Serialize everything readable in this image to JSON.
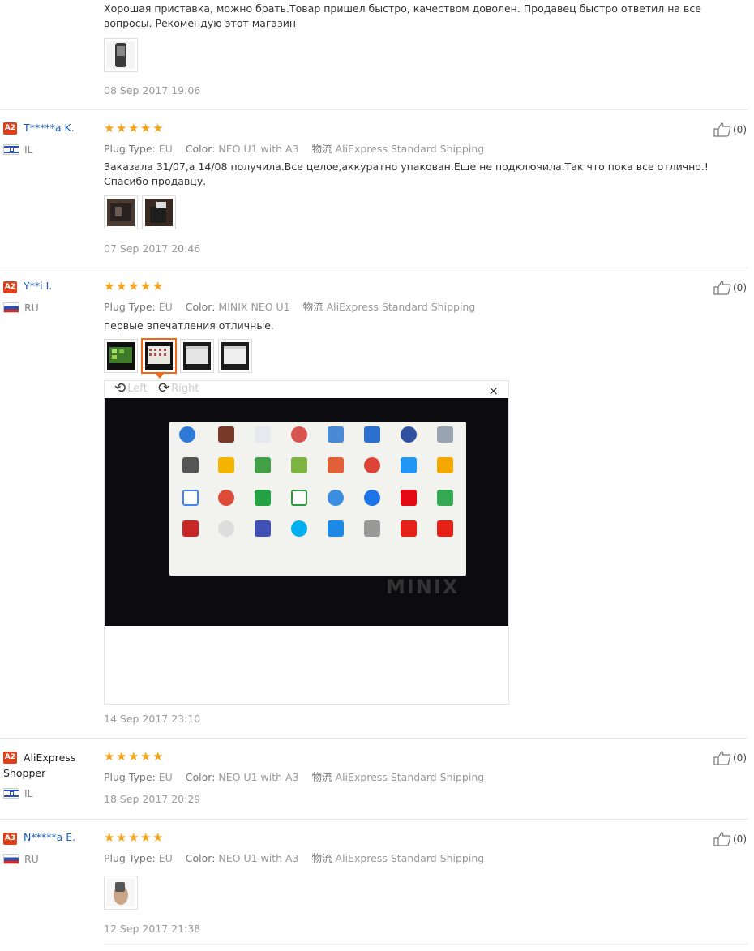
{
  "colors": {
    "accent": "#f06a16",
    "star": "#f7a21b",
    "link": "#1a5eb7",
    "level_badge": "#d9421c"
  },
  "labels": {
    "plug_type": "Plug Type:",
    "color": "Color:",
    "shipping": "物流"
  },
  "reviews": [
    {
      "text": "Хорошая приставка, можно брать.Товар пришел быстро, качеством доволен. Продавец быстро ответил на все вопросы. Рекомендую этот магазин",
      "date": "08 Sep 2017 19:06"
    },
    {
      "level": "A2",
      "name": "T*****a K.",
      "country": "IL",
      "rating": 5,
      "plug": "EU",
      "color": "NEO U1 with A3",
      "shipping": "AliExpress Standard Shipping",
      "text": "Заказала 31/07,а 14/08 получила.Все целое,аккуратно упакован.Еще не подключила.Так что пока все отлично.!Спасибо продавцу.",
      "likes": "(0)",
      "date": "07 Sep 2017 20:46"
    },
    {
      "level": "A2",
      "name": "Y**i I.",
      "country": "RU",
      "rating": 5,
      "plug": "EU",
      "color": "MINIX NEO U1",
      "shipping": "AliExpress Standard Shipping",
      "text": "первые впечатления отличные.",
      "likes": "(0)",
      "date": "14 Sep 2017 23:10",
      "viewer": {
        "rotate_left": "Left",
        "rotate_right": "Right",
        "close": "×",
        "brand": "MINIX"
      }
    },
    {
      "level": "A2",
      "name": "AliExpress Shopper",
      "country": "IL",
      "rating": 5,
      "plug": "EU",
      "color": "NEO U1 with A3",
      "shipping": "AliExpress Standard Shipping",
      "likes": "(0)",
      "date": "18 Sep 2017 20:29"
    },
    {
      "level": "A3",
      "name": "N*****a E.",
      "country": "RU",
      "rating": 5,
      "plug": "EU",
      "color": "NEO U1 with A3",
      "shipping": "AliExpress Standard Shipping",
      "likes": "(0)",
      "date": "12 Sep 2017 21:38"
    }
  ]
}
